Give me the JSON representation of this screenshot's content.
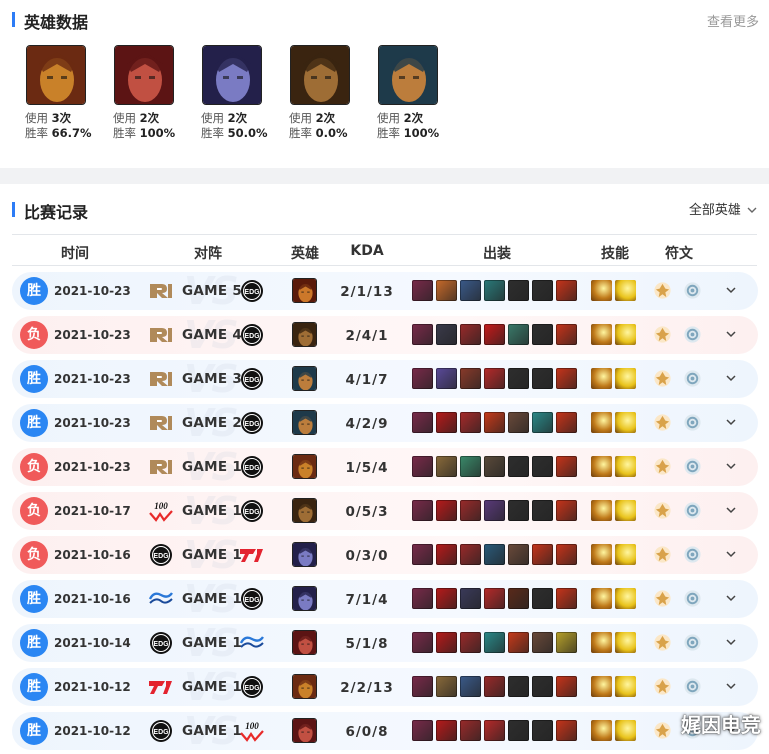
{
  "hero_section": {
    "title": "英雄数据",
    "more": "查看更多",
    "use_label": "使用",
    "winrate_label": "胜率",
    "heroes": [
      {
        "icon": "jarvan-portrait-icon",
        "uses": "3次",
        "winrate": "66.7%",
        "colors": [
          "#6b2a12",
          "#d9902e"
        ]
      },
      {
        "icon": "leesin-portrait-icon",
        "uses": "2次",
        "winrate": "100%",
        "colors": [
          "#5c1414",
          "#d25a4a"
        ]
      },
      {
        "icon": "talon-portrait-icon",
        "uses": "2次",
        "winrate": "50.0%",
        "colors": [
          "#23204a",
          "#8a8cd8"
        ]
      },
      {
        "icon": "xinzhao-portrait-icon",
        "uses": "2次",
        "winrate": "0.0%",
        "colors": [
          "#3a2410",
          "#b07a3c"
        ]
      },
      {
        "icon": "olaf-portrait-icon",
        "uses": "2次",
        "winrate": "100%",
        "colors": [
          "#1e3a4a",
          "#d88a3a"
        ]
      }
    ]
  },
  "match_section": {
    "title": "比赛记录",
    "filter": "全部英雄",
    "headers": {
      "time": "时间",
      "matchup": "对阵",
      "hero": "英雄",
      "kda": "KDA",
      "items": "出装",
      "spells": "技能",
      "runes": "符文"
    },
    "vs_watermark": "VS",
    "matches": [
      {
        "result": "胜",
        "outcome": "win",
        "date": "2021-10-23",
        "game": "GAME 5",
        "left_team": "rng-logo",
        "right_team": "edg-logo",
        "hero_colors": [
          "#5a1a0a",
          "#e08a30"
        ],
        "kda": "2/1/13",
        "items": [
          "#7a2a4a",
          "#c86a2a",
          "#3a5a8a",
          "#2a7a7a",
          "#2e2e2e",
          "#2e2e2e",
          "#c8341a"
        ]
      },
      {
        "result": "负",
        "outcome": "loss",
        "date": "2021-10-23",
        "game": "GAME 4",
        "left_team": "rng-logo",
        "right_team": "edg-logo",
        "hero_colors": [
          "#3a2410",
          "#b07a3c"
        ],
        "kda": "2/4/1",
        "items": [
          "#7a2a4a",
          "#3a3a4a",
          "#9a2a2a",
          "#c81a1a",
          "#3a7a6a",
          "#2e2e2e",
          "#c8341a"
        ]
      },
      {
        "result": "胜",
        "outcome": "win",
        "date": "2021-10-23",
        "game": "GAME 3",
        "left_team": "rng-logo",
        "right_team": "edg-logo",
        "hero_colors": [
          "#1e3a4a",
          "#d88a3a"
        ],
        "kda": "4/1/7",
        "items": [
          "#7a2a4a",
          "#5a4a9a",
          "#8a3a2a",
          "#b82a2a",
          "#2e2e2e",
          "#2e2e2e",
          "#c8341a"
        ]
      },
      {
        "result": "胜",
        "outcome": "win",
        "date": "2021-10-23",
        "game": "GAME 2",
        "left_team": "rng-logo",
        "right_team": "edg-logo",
        "hero_colors": [
          "#1e3a4a",
          "#d88a3a"
        ],
        "kda": "4/2/9",
        "items": [
          "#7a2a4a",
          "#b81a1a",
          "#a82a2a",
          "#c83a1a",
          "#6a4a3a",
          "#2a8a8a",
          "#c8341a"
        ]
      },
      {
        "result": "负",
        "outcome": "loss",
        "date": "2021-10-23",
        "game": "GAME 1",
        "left_team": "rng-logo",
        "right_team": "edg-logo",
        "hero_colors": [
          "#6b2a12",
          "#d9902e"
        ],
        "kda": "1/5/4",
        "items": [
          "#7a2a4a",
          "#8a6a3a",
          "#3a8a6a",
          "#5a4a3a",
          "#2e2e2e",
          "#2e2e2e",
          "#c8341a"
        ]
      },
      {
        "result": "负",
        "outcome": "loss",
        "date": "2021-10-17",
        "game": "GAME 1",
        "left_team": "100t-logo",
        "right_team": "edg-logo",
        "hero_colors": [
          "#3a2410",
          "#b07a3c"
        ],
        "kda": "0/5/3",
        "items": [
          "#7a2a4a",
          "#b81a1a",
          "#9a2a2a",
          "#5a3a7a",
          "#2e2e2e",
          "#2e2e2e",
          "#c8341a"
        ]
      },
      {
        "result": "负",
        "outcome": "loss",
        "date": "2021-10-16",
        "game": "GAME 1",
        "left_team": "edg-logo",
        "right_team": "t1-logo",
        "hero_colors": [
          "#23204a",
          "#8a8cd8"
        ],
        "kda": "0/3/0",
        "items": [
          "#7a2a4a",
          "#b81a1a",
          "#9a2a2a",
          "#2a5a7a",
          "#6a4a3a",
          "#c8341a",
          "#c8341a"
        ]
      },
      {
        "result": "胜",
        "outcome": "win",
        "date": "2021-10-16",
        "game": "GAME 1",
        "left_team": "dfm-logo",
        "right_team": "edg-logo",
        "hero_colors": [
          "#23204a",
          "#8a8cd8"
        ],
        "kda": "7/1/4",
        "items": [
          "#7a2a4a",
          "#b81a1a",
          "#3a3a5a",
          "#b82a2a",
          "#5a2a1a",
          "#2e2e2e",
          "#c8341a"
        ]
      },
      {
        "result": "胜",
        "outcome": "win",
        "date": "2021-10-14",
        "game": "GAME 1",
        "left_team": "edg-logo",
        "right_team": "dfm-logo",
        "hero_colors": [
          "#5c1414",
          "#d25a4a"
        ],
        "kda": "5/1/8",
        "items": [
          "#7a2a4a",
          "#b81a1a",
          "#9a2a2a",
          "#2a8a8a",
          "#c83a1a",
          "#6a4a3a",
          "#b8a22a"
        ]
      },
      {
        "result": "胜",
        "outcome": "win",
        "date": "2021-10-12",
        "game": "GAME 1",
        "left_team": "t1-logo",
        "right_team": "edg-logo",
        "hero_colors": [
          "#6b2a12",
          "#d9902e"
        ],
        "kda": "2/2/13",
        "items": [
          "#7a2a4a",
          "#8a6a3a",
          "#3a5a8a",
          "#9a2a2a",
          "#2e2e2e",
          "#2e2e2e",
          "#c8341a"
        ]
      },
      {
        "result": "胜",
        "outcome": "win",
        "date": "2021-10-12",
        "game": "GAME 1",
        "left_team": "edg-logo",
        "right_team": "100t-logo",
        "hero_colors": [
          "#5c1414",
          "#d25a4a"
        ],
        "kda": "6/0/8",
        "items": [
          "#7a2a4a",
          "#b81a1a",
          "#9a2a2a",
          "#b82a2a",
          "#2e2e2e",
          "#2e2e2e",
          "#c8341a"
        ]
      }
    ],
    "spell_colors": [
      "#c07a1a",
      "#e8c21a"
    ],
    "rune_icons": [
      "precision-rune-icon",
      "sorcery-rune-icon"
    ]
  },
  "watermark": "娓因电竞"
}
